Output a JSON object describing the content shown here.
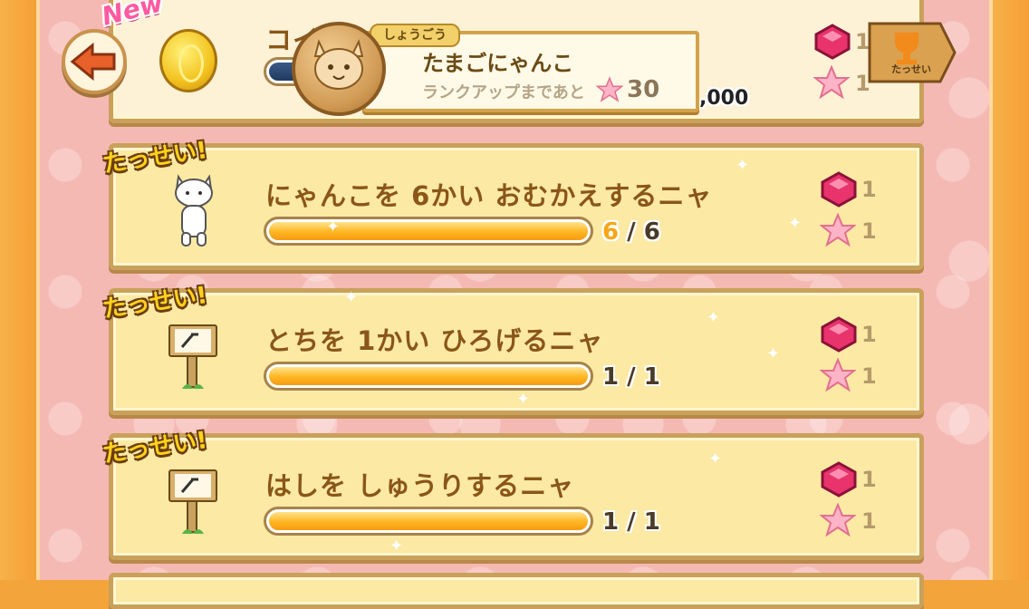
{
  "header": {
    "new_tag": "New",
    "top_title_partial": "コイ",
    "coins_total_partial": ",000"
  },
  "rank": {
    "tag": "しょうごう",
    "name": "たまごにゃんこ",
    "next_label": "ランクアップまであと",
    "next_value": "30"
  },
  "trophy": {
    "label": "たっせい"
  },
  "top_rewards": {
    "gem": "1",
    "star": "1"
  },
  "achievements": [
    {
      "badge": "たっせい!",
      "title": "にゃんこを 6かい おむかえするニャ",
      "current": "6",
      "sep": "/",
      "total": "6",
      "progress": 1.0,
      "gem": "1",
      "star": "1",
      "icon": "white-cat-icon"
    },
    {
      "badge": "たっせい!",
      "title": "とちを 1かい ひろげるニャ",
      "current": "1",
      "sep": "/",
      "total": "1",
      "progress": 1.0,
      "gem": "1",
      "star": "1",
      "icon": "signboard-icon"
    },
    {
      "badge": "たっせい!",
      "title": "はしを しゅうりするニャ",
      "current": "1",
      "sep": "/",
      "total": "1",
      "progress": 1.0,
      "gem": "1",
      "star": "1",
      "icon": "signboard-icon"
    }
  ],
  "colors": {
    "panel": "#fbe9a4",
    "panel_border": "#c9a15b",
    "title": "#8a5618",
    "accent": "#f7a617",
    "background": "#f5b9b4"
  }
}
